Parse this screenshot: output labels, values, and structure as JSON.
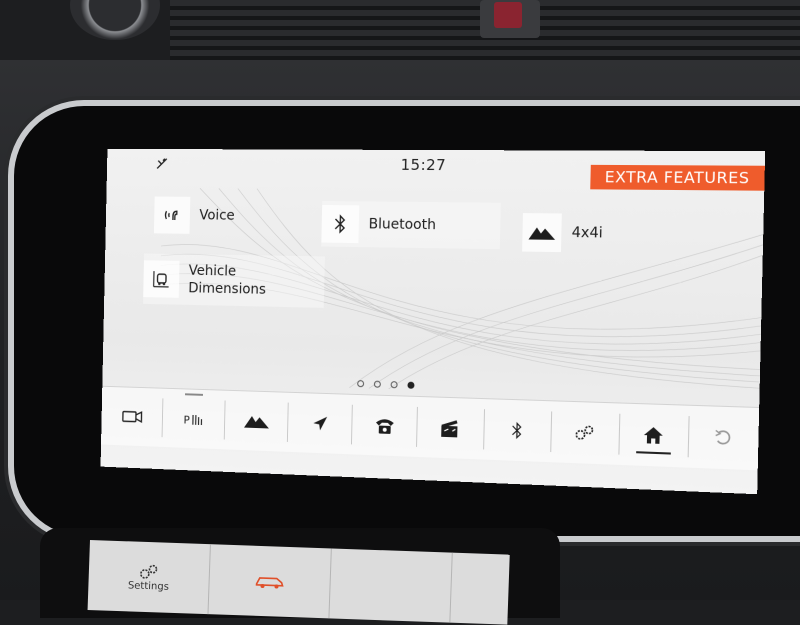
{
  "status_bar": {
    "time": "15:27",
    "left_icon": "no-signal-icon",
    "extra_features_label": "EXTRA FEATURES"
  },
  "tiles": {
    "voice": {
      "label": "Voice",
      "icon": "voice-icon"
    },
    "bluetooth": {
      "label": "Bluetooth",
      "icon": "bluetooth-icon"
    },
    "four_by_four": {
      "label": "4x4i",
      "icon": "mountain-icon"
    },
    "vehicle_dimensions": {
      "line1": "Vehicle",
      "line2": "Dimensions",
      "icon": "vehicle-dimensions-icon"
    }
  },
  "pager": {
    "total": 4,
    "active_index": 3
  },
  "nav_bar": {
    "items": [
      {
        "icon": "camera-icon"
      },
      {
        "icon": "park-assist-icon"
      },
      {
        "icon": "terrain-icon"
      },
      {
        "icon": "navigation-arrow-icon"
      },
      {
        "icon": "phone-icon"
      },
      {
        "icon": "media-clapper-icon"
      },
      {
        "icon": "bluetooth-icon"
      },
      {
        "icon": "settings-gears-icon"
      },
      {
        "icon": "home-icon"
      },
      {
        "icon": "back-icon"
      }
    ]
  },
  "lower_panel": {
    "settings_label": "Settings"
  },
  "colors": {
    "accent": "#ef5c2c",
    "screen_bg": "#efefef",
    "icon": "#1d1d1d"
  }
}
